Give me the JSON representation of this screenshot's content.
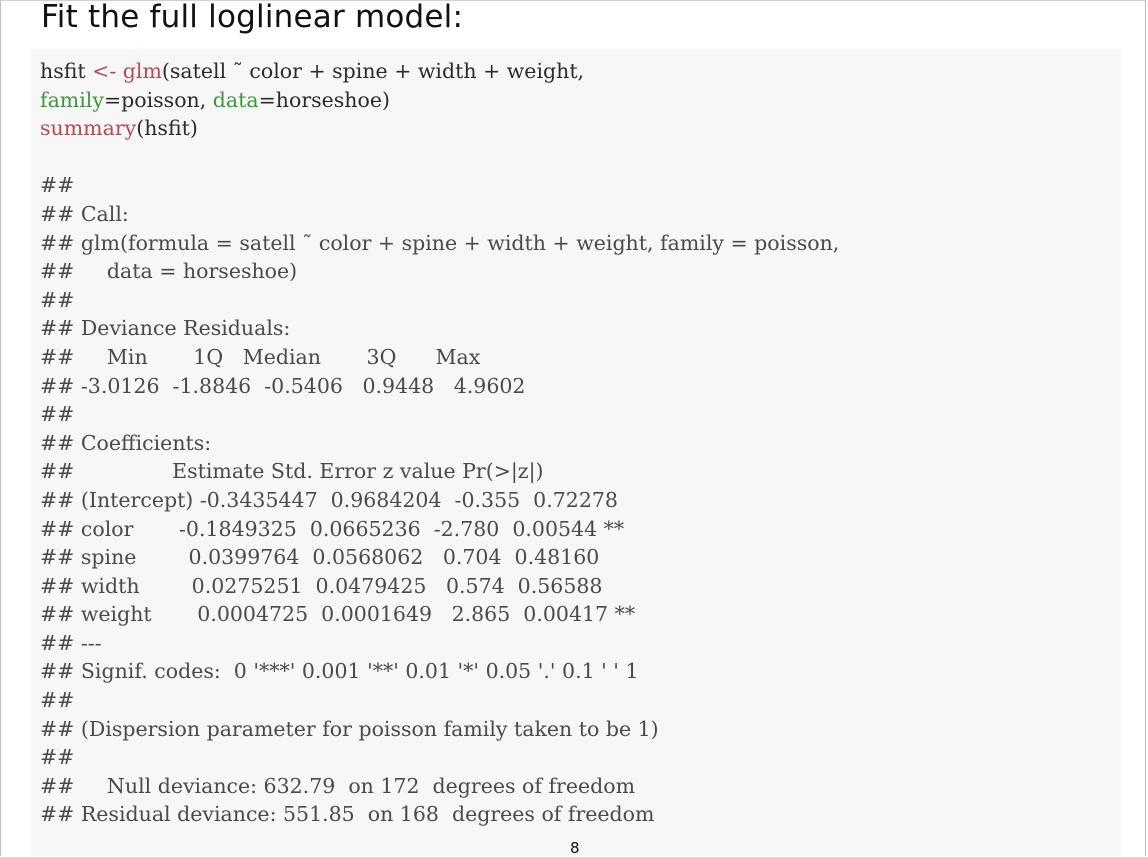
{
  "slide": {
    "title": "Fit the full loglinear model:",
    "page_number": "8"
  },
  "code": {
    "line1": {
      "a": "hsfit ",
      "b": "<- ",
      "c": "glm",
      "d": "(satell ˜ color + spine + width + weight,"
    },
    "line2": {
      "a": "family",
      "b": "=poisson, ",
      "c": "data",
      "d": "=horseshoe)"
    },
    "line3": {
      "a": "summary",
      "b": "(hsfit)"
    }
  },
  "output": {
    "lines": [
      "##",
      "## Call:",
      "## glm(formula = satell ˜ color + spine + width + weight, family = poisson,",
      "##     data = horseshoe)",
      "##",
      "## Deviance Residuals:",
      "##     Min       1Q   Median       3Q      Max",
      "## -3.0126  -1.8846  -0.5406   0.9448   4.9602",
      "##",
      "## Coefficients:",
      "##               Estimate Std. Error z value Pr(>|z|)",
      "## (Intercept) -0.3435447  0.9684204  -0.355  0.72278",
      "## color       -0.1849325  0.0665236  -2.780  0.00544 **",
      "## spine        0.0399764  0.0568062   0.704  0.48160",
      "## width        0.0275251  0.0479425   0.574  0.56588",
      "## weight       0.0004725  0.0001649   2.865  0.00417 **",
      "## ---",
      "## Signif. codes:  0 '***' 0.001 '**' 0.01 '*' 0.05 '.' 0.1 ' ' 1",
      "##",
      "## (Dispersion parameter for poisson family taken to be 1)",
      "##",
      "##     Null deviance: 632.79  on 172  degrees of freedom",
      "## Residual deviance: 551.85  on 168  degrees of freedom"
    ]
  }
}
